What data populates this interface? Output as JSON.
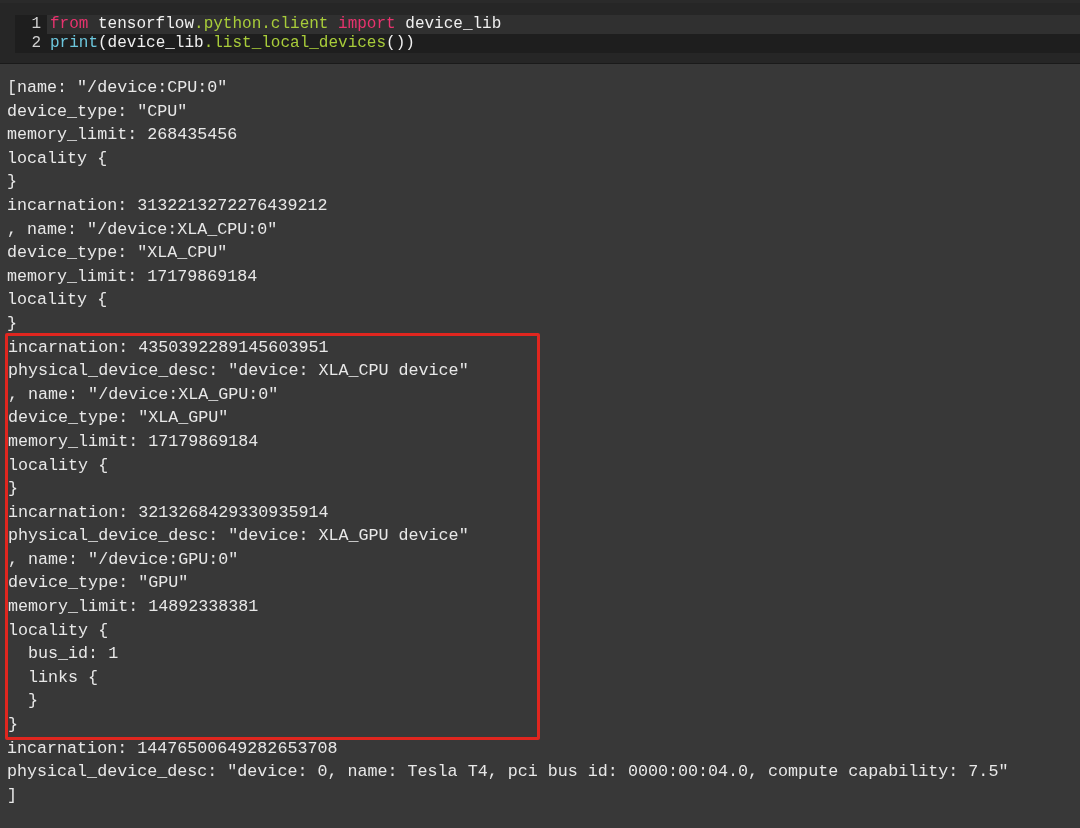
{
  "code_cell": {
    "lines": [
      {
        "number": "1",
        "current": true,
        "tokens": [
          {
            "kind": "keyword",
            "text": "from"
          },
          {
            "kind": "plain",
            "text": " tensorflow"
          },
          {
            "kind": "attr",
            "text": ".python.client"
          },
          {
            "kind": "keyword",
            "text": " import"
          },
          {
            "kind": "plain",
            "text": " device_lib"
          }
        ]
      },
      {
        "number": "2",
        "current": false,
        "tokens": [
          {
            "kind": "builtin",
            "text": "print"
          },
          {
            "kind": "plain",
            "text": "(device_lib"
          },
          {
            "kind": "attr",
            "text": ".list_local_devices"
          },
          {
            "kind": "plain",
            "text": "())"
          }
        ]
      }
    ]
  },
  "output": {
    "blocks": [
      {
        "highlighted": false,
        "lines": [
          "[name: \"/device:CPU:0\"",
          "device_type: \"CPU\"",
          "memory_limit: 268435456",
          "locality {",
          "}",
          "incarnation: 3132213272276439212",
          ", name: \"/device:XLA_CPU:0\"",
          "device_type: \"XLA_CPU\"",
          "memory_limit: 17179869184",
          "locality {",
          "}"
        ]
      },
      {
        "highlighted": true,
        "lines": [
          "incarnation: 4350392289145603951",
          "physical_device_desc: \"device: XLA_CPU device\"",
          ", name: \"/device:XLA_GPU:0\"",
          "device_type: \"XLA_GPU\"",
          "memory_limit: 17179869184",
          "locality {",
          "}",
          "incarnation: 3213268429330935914",
          "physical_device_desc: \"device: XLA_GPU device\"",
          ", name: \"/device:GPU:0\"",
          "device_type: \"GPU\"",
          "memory_limit: 14892338381",
          "locality {",
          "  bus_id: 1",
          "  links {",
          "  }",
          "}"
        ]
      },
      {
        "highlighted": false,
        "lines": [
          "incarnation: 14476500649282653708",
          "physical_device_desc: \"device: 0, name: Tesla T4, pci bus id: 0000:00:04.0, compute capability: 7.5\"",
          "]"
        ]
      }
    ]
  }
}
